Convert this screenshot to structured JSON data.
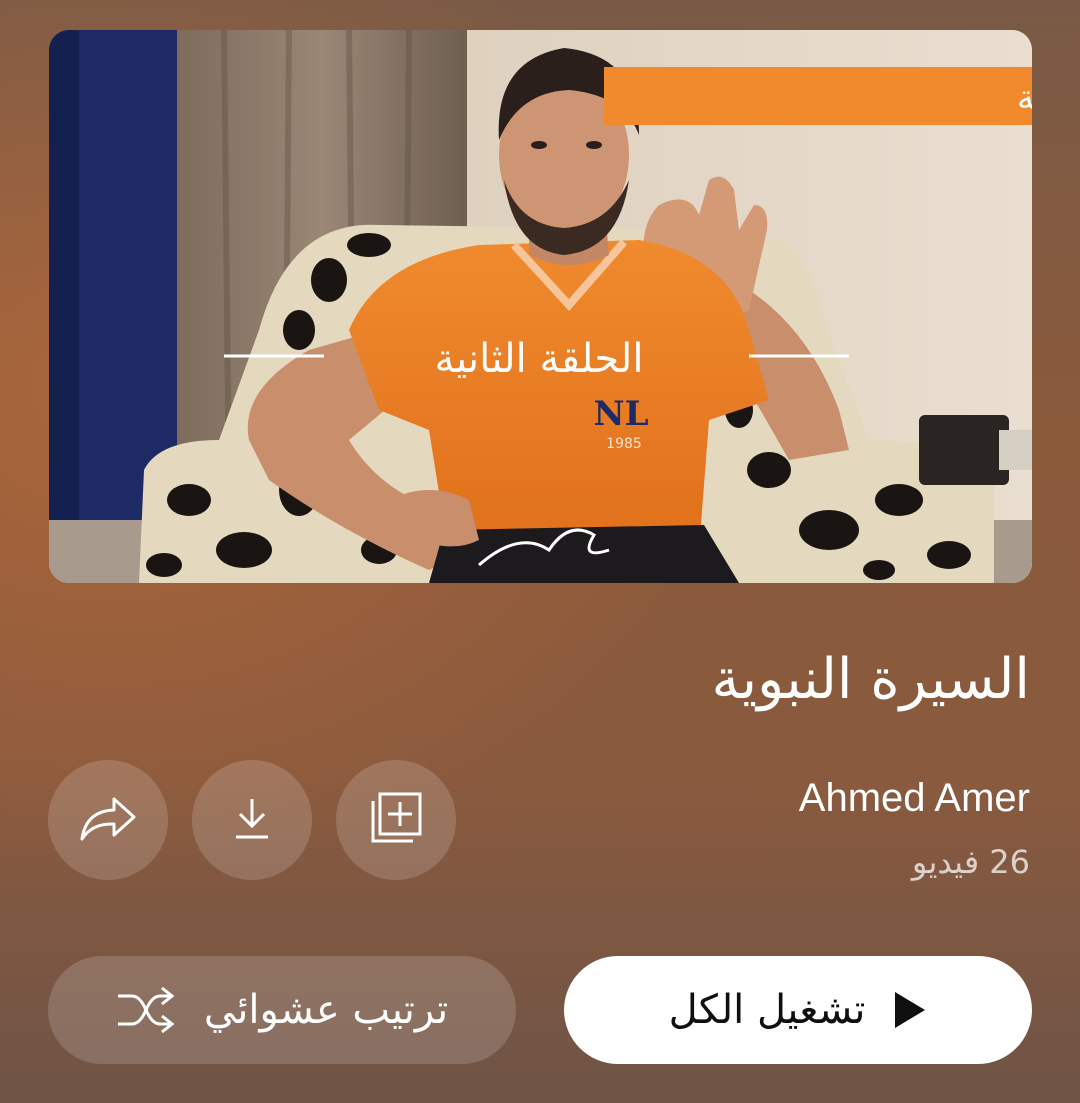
{
  "thumbnail": {
    "banner_text": "سلسلة السيرة النبوية",
    "episode_text": "الحلقة الثانية",
    "shirt_badge": "NL",
    "shirt_year": "1985"
  },
  "playlist": {
    "title": "السيرة النبوية",
    "channel": "Ahmed Amer",
    "video_count": "26 فيديو"
  },
  "actions": {
    "play_all_label": "تشغيل الكل",
    "shuffle_label": "ترتيب عشوائي"
  },
  "icons": {
    "share": "share-icon",
    "download": "download-icon",
    "save": "add-to-library-icon",
    "play": "play-icon",
    "shuffle": "shuffle-icon"
  },
  "colors": {
    "accent_orange": "#f08a2c",
    "play_button_bg": "#ffffff",
    "text_primary": "#ffffff"
  }
}
